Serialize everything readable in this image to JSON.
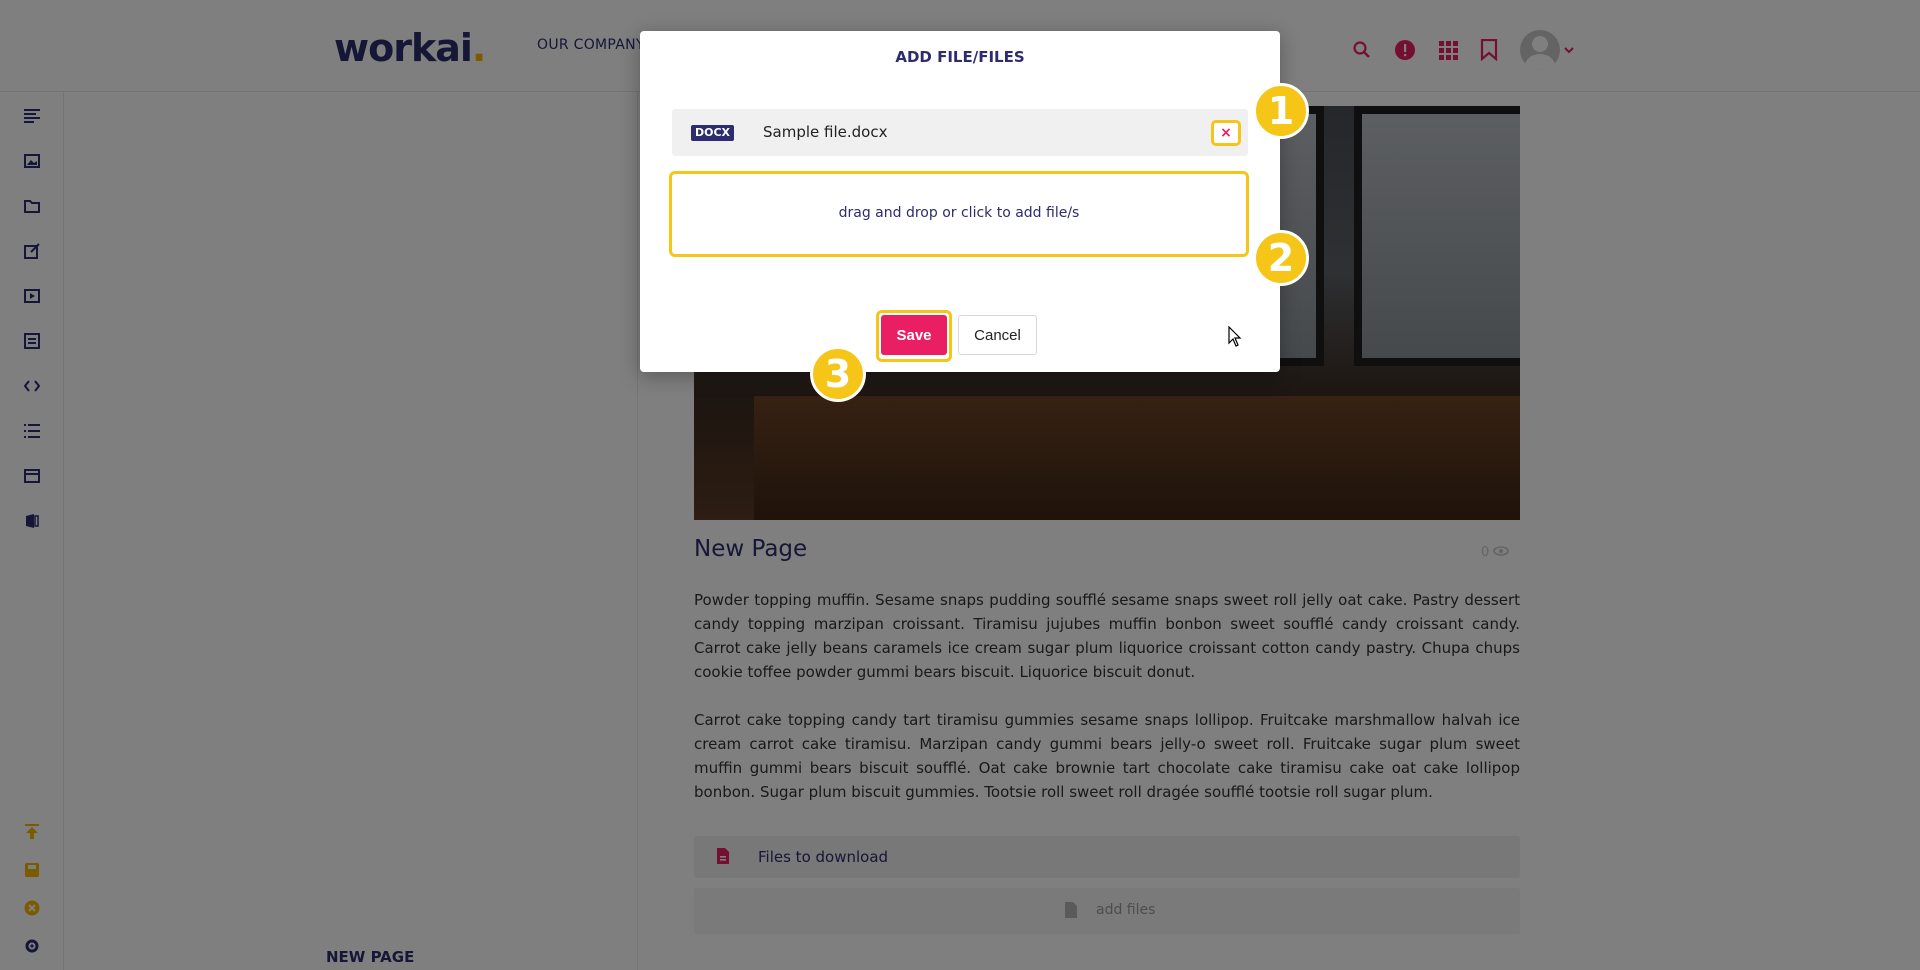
{
  "app": {
    "logo_text": "workai",
    "logo_dot": ".",
    "nav_item": "OUR COMPANY"
  },
  "sidebar": {
    "title": "NEW PAGE"
  },
  "page": {
    "title": "New Page",
    "views": "0",
    "paragraph_1": "Powder topping muffin. Sesame snaps pudding soufflé sesame snaps sweet roll jelly oat cake. Pastry dessert candy topping marzipan croissant. Tiramisu jujubes muffin bonbon sweet soufflé candy croissant candy. Carrot cake jelly beans caramels ice cream sugar plum liquorice croissant cotton candy pastry. Chupa chups cookie toffee powder gummi bears biscuit. Liquorice biscuit donut.",
    "paragraph_2": "Carrot cake topping candy tart tiramisu gummies sesame snaps lollipop. Fruitcake marshmallow halvah ice cream carrot cake tiramisu. Marzipan candy gummi bears jelly-o sweet roll. Fruitcake sugar plum sweet muffin gummi bears biscuit soufflé. Oat cake brownie tart chocolate cake tiramisu cake oat cake lollipop bonbon. Sugar plum biscuit gummies. Tootsie roll sweet roll dragée soufflé tootsie roll sugar plum.",
    "files_section_label": "Files to download",
    "add_files_label": "add files"
  },
  "modal": {
    "title": "ADD FILE/FILES",
    "file_badge": "DOCX",
    "file_name": "Sample file.docx",
    "remove_label": "×",
    "dropzone_label": "drag and drop or click to add file/s",
    "save_label": "Save",
    "cancel_label": "Cancel"
  },
  "callouts": [
    "1",
    "2",
    "3"
  ],
  "colors": {
    "brand": "#2c2c6e",
    "accent": "#e91e63",
    "highlight": "#f5c518"
  },
  "icons": {
    "top": [
      "search-icon",
      "alert-icon",
      "apps-grid-icon",
      "bookmark-icon",
      "user-avatar",
      "chevron-down-icon"
    ],
    "rail": [
      "text-icon",
      "image-icon",
      "folder-icon",
      "edit-link-icon",
      "video-icon",
      "form-icon",
      "code-icon",
      "list-icon",
      "card-icon",
      "office-icon"
    ],
    "rail_bottom": [
      "publish-icon",
      "save-icon",
      "close-circle-icon",
      "settings-icon"
    ]
  }
}
